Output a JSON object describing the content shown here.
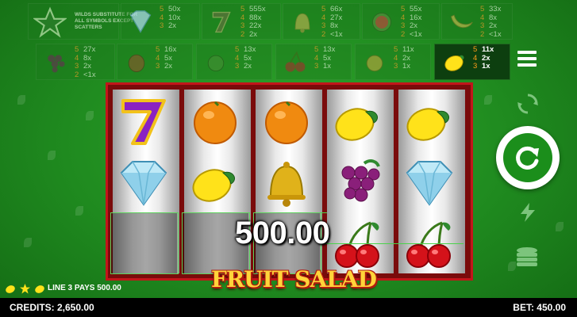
{
  "paytable": {
    "wild": {
      "text": "WILDS SUBSTITUTE FOR ALL SYMBOLS EXCEPT SCATTERS"
    },
    "diamond": {
      "rows": [
        [
          "5",
          "50x"
        ],
        [
          "4",
          "10x"
        ],
        [
          "3",
          "2x"
        ]
      ]
    },
    "seven": {
      "rows": [
        [
          "5",
          "555x"
        ],
        [
          "4",
          "88x"
        ],
        [
          "3",
          "22x"
        ],
        [
          "2",
          "2x"
        ]
      ]
    },
    "bell": {
      "rows": [
        [
          "5",
          "66x"
        ],
        [
          "4",
          "27x"
        ],
        [
          "3",
          "8x"
        ],
        [
          "2",
          "<1x"
        ]
      ]
    },
    "watermelon": {
      "rows": [
        [
          "5",
          "55x"
        ],
        [
          "4",
          "16x"
        ],
        [
          "3",
          "2x"
        ],
        [
          "2",
          "<1x"
        ]
      ]
    },
    "banana": {
      "rows": [
        [
          "5",
          "33x"
        ],
        [
          "4",
          "8x"
        ],
        [
          "3",
          "2x"
        ],
        [
          "2",
          "<1x"
        ]
      ]
    },
    "grape": {
      "rows": [
        [
          "5",
          "27x"
        ],
        [
          "4",
          "8x"
        ],
        [
          "3",
          "2x"
        ],
        [
          "2",
          "<1x"
        ]
      ]
    },
    "plum": {
      "rows": [
        [
          "5",
          "16x"
        ],
        [
          "4",
          "5x"
        ],
        [
          "3",
          "2x"
        ]
      ]
    },
    "apple": {
      "rows": [
        [
          "5",
          "13x"
        ],
        [
          "4",
          "5x"
        ],
        [
          "3",
          "2x"
        ]
      ]
    },
    "cherry": {
      "rows": [
        [
          "5",
          "13x"
        ],
        [
          "4",
          "5x"
        ],
        [
          "3",
          "1x"
        ]
      ]
    },
    "orange": {
      "rows": [
        [
          "5",
          "11x"
        ],
        [
          "4",
          "2x"
        ],
        [
          "3",
          "1x"
        ]
      ]
    },
    "lemon": {
      "rows": [
        [
          "5",
          "11x"
        ],
        [
          "4",
          "2x"
        ],
        [
          "3",
          "1x"
        ]
      ]
    }
  },
  "reels": [
    [
      "seven",
      "diamond",
      "empty"
    ],
    [
      "orange",
      "lemon",
      "empty"
    ],
    [
      "orange",
      "bell",
      "empty"
    ],
    [
      "lemon",
      "grape",
      "cherry"
    ],
    [
      "lemon",
      "diamond",
      "cherry"
    ]
  ],
  "win": {
    "amount": "500.00"
  },
  "logo": {
    "text": "FRUIT SALAD"
  },
  "status": {
    "line_text": "LINE 3 PAYS 500.00"
  },
  "footer": {
    "credits": "CREDITS: 2,650.00",
    "bet": "BET: 450.00"
  },
  "colors": {
    "accent_green": "#1b8e1b",
    "frame_red": "#c2161a",
    "payout_orange": "#e79b2a"
  }
}
